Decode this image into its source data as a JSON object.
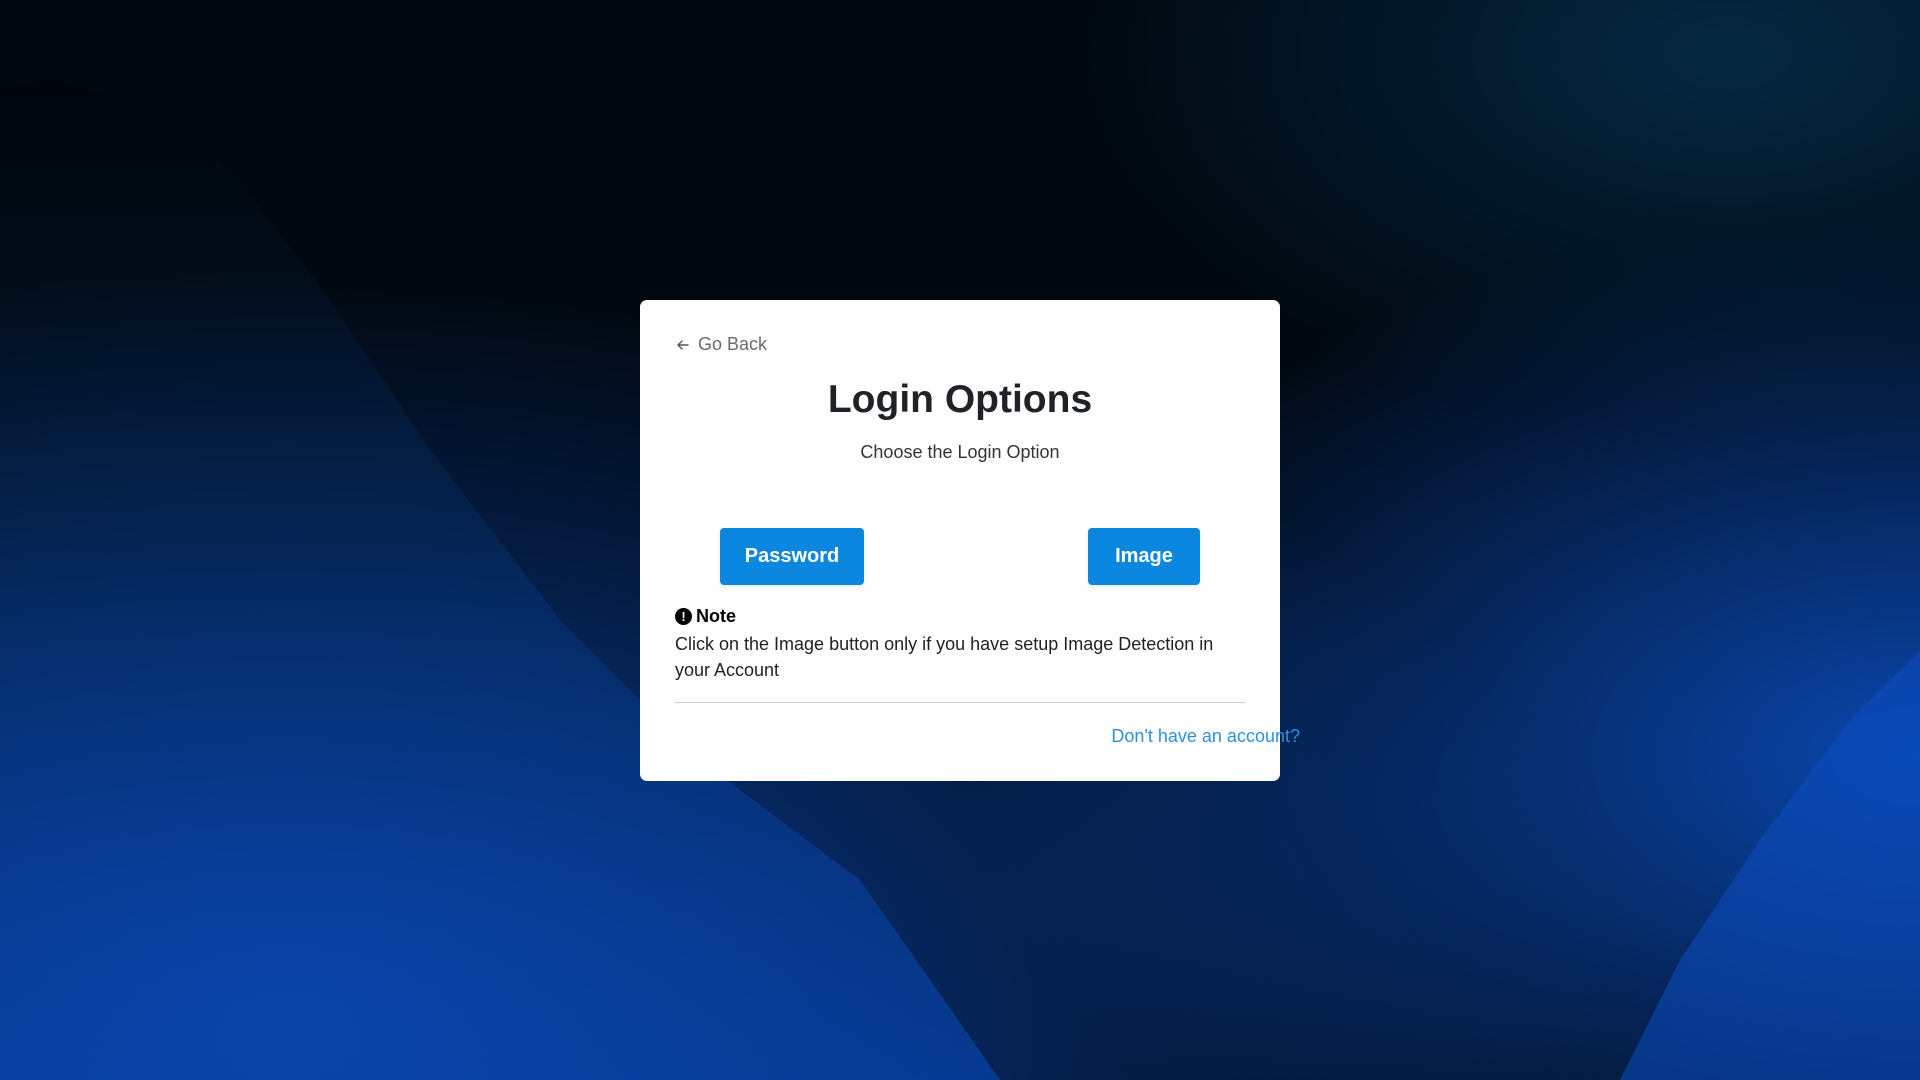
{
  "colors": {
    "accent": "#0b87e0",
    "link": "#2d8fe0",
    "background_dark": "#020a14",
    "background_blue": "#0a3fa8"
  },
  "nav": {
    "back_icon": "arrow-left-icon",
    "back_label": "Go Back"
  },
  "header": {
    "title": "Login Options",
    "subtitle": "Choose the Login Option"
  },
  "options": {
    "password_label": "Password",
    "image_label": "Image"
  },
  "note": {
    "icon": "exclamation-circle-icon",
    "heading": "Note",
    "text": "Click on the Image button only if you have setup Image Detection in your Account"
  },
  "footer": {
    "signup_link": "Don't have an account?"
  }
}
